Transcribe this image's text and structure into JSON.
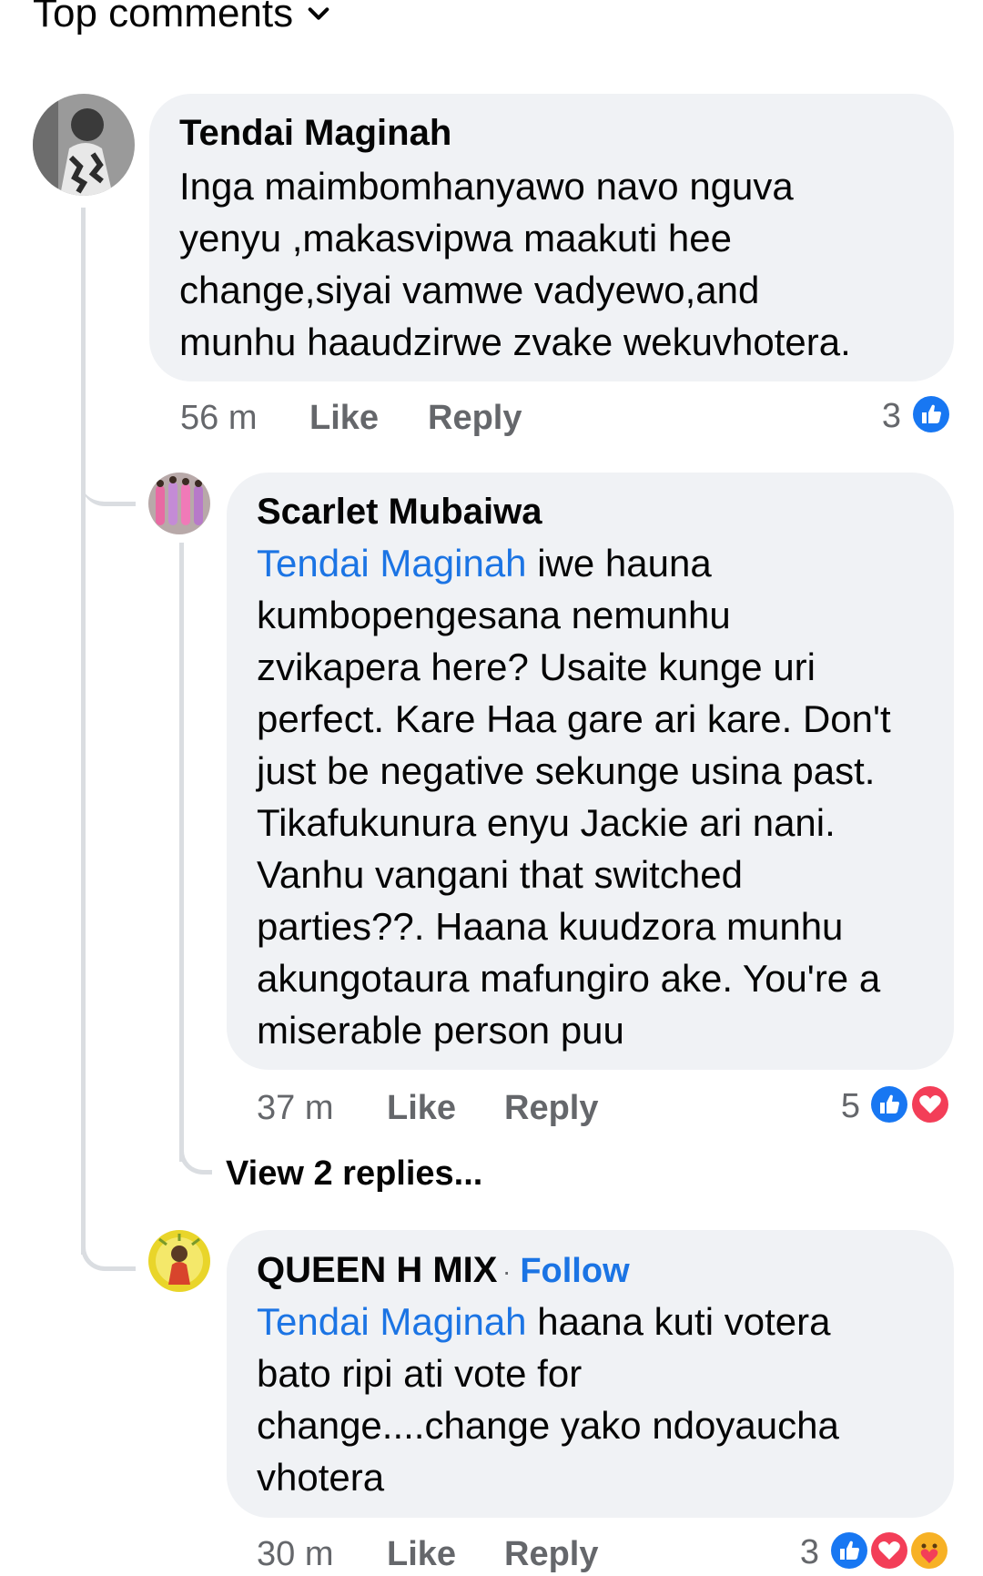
{
  "header": {
    "sort_label": "Top comments"
  },
  "comments": [
    {
      "author": "Tendai Maginah",
      "text_lines": [
        "Inga maimbomhanyawo navo nguva",
        "yenyu ,makasvipwa maakuti hee",
        "change,siyai vamwe vadyewo,and",
        "munhu haaudzirwe zvake wekuvhotera."
      ],
      "time": "56 m",
      "like_label": "Like",
      "reply_label": "Reply",
      "reaction_count": "3",
      "reactions": [
        "like"
      ]
    },
    {
      "author": "Scarlet Mubaiwa",
      "mention": "Tendai Maginah",
      "text_first": " iwe hauna",
      "text_lines": [
        "kumbopengesana nemunhu",
        "zvikapera here? Usaite kunge uri",
        "perfect. Kare Haa gare ari kare. Don't",
        "just be negative sekunge usina past.",
        "Tikafukunura enyu Jackie ari nani.",
        "Vanhu vangani that switched",
        "parties??. Haana kuudzora munhu",
        "akungotaura mafungiro ake. You're a",
        "miserable person puu"
      ],
      "time": "37 m",
      "like_label": "Like",
      "reply_label": "Reply",
      "reaction_count": "5",
      "reactions": [
        "like",
        "love"
      ],
      "view_replies_label": "View 2 replies..."
    },
    {
      "author": "QUEEN H MIX",
      "follow_label": "Follow",
      "mention": "Tendai Maginah",
      "text_first": " haana kuti votera",
      "text_lines": [
        "bato ripi ati vote for",
        "change....change yako ndoyaucha",
        "vhotera"
      ],
      "time": "30 m",
      "like_label": "Like",
      "reply_label": "Reply",
      "reaction_count": "3",
      "reactions": [
        "like",
        "love",
        "care"
      ]
    }
  ],
  "colors": {
    "bubble": "#f0f2f5",
    "link": "#1b74e4",
    "secondary_text": "#65676b",
    "like": "#1877f2",
    "love": "#f33e58",
    "care": "#f7b125"
  }
}
